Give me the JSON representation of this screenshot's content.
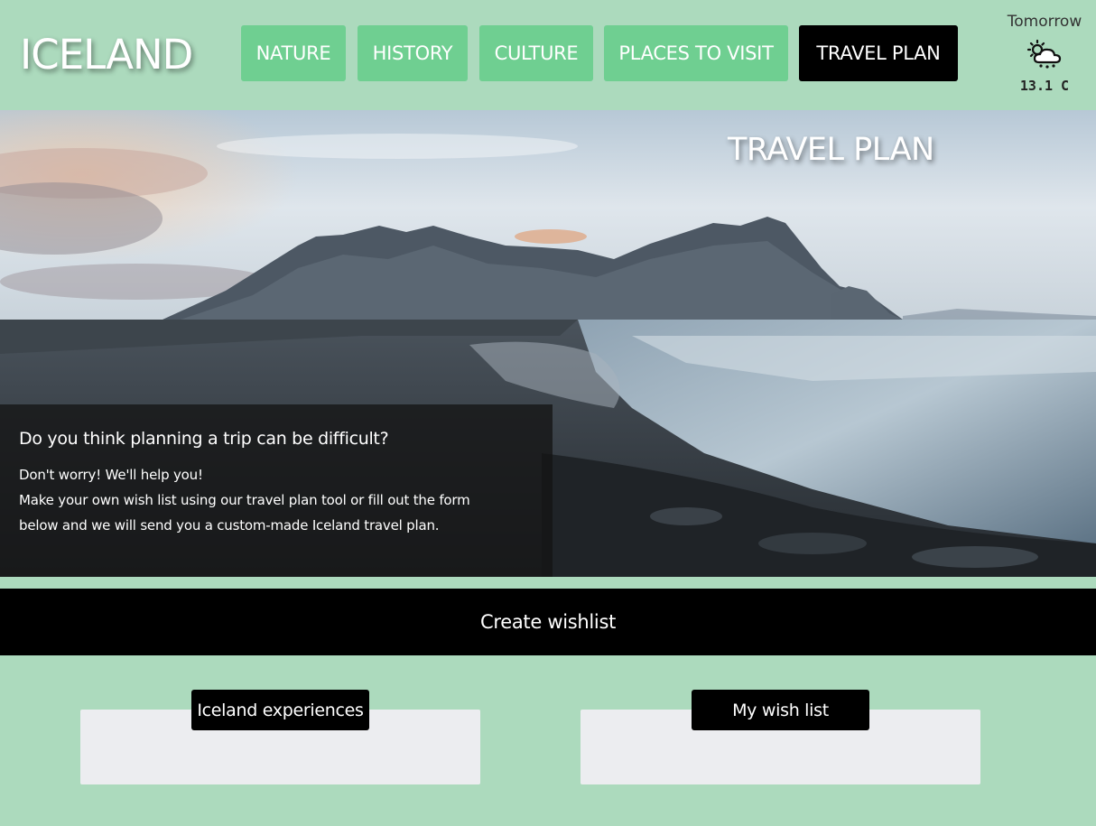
{
  "header": {
    "logo": "ICELAND",
    "nav": [
      {
        "label": "NATURE"
      },
      {
        "label": "HISTORY"
      },
      {
        "label": "CULTURE"
      },
      {
        "label": "PLACES TO VISIT"
      },
      {
        "label": "TRAVEL PLAN",
        "active": true
      }
    ],
    "weather": {
      "day": "Tomorrow",
      "icon": "cloud-snow-sun-icon",
      "temp": "13.1 C"
    }
  },
  "hero": {
    "title": "TRAVEL PLAN",
    "image": "mountain-beach-landscape",
    "heading": "Do you think planning a trip can be difficult?",
    "line1": "Don't worry! We'll help you!",
    "line2": "Make your own wish list using our travel plan tool or fill out the form",
    "line3": "below and we will send you a custom-made Iceland travel plan."
  },
  "wishlist": {
    "bar_label": "Create wishlist",
    "panels": [
      {
        "label": "Iceland experiences"
      },
      {
        "label": "My wish list"
      }
    ]
  },
  "colors": {
    "background": "#acdabd",
    "nav_button": "#6fcf91",
    "active": "#000000",
    "panel": "#ecedf0"
  }
}
